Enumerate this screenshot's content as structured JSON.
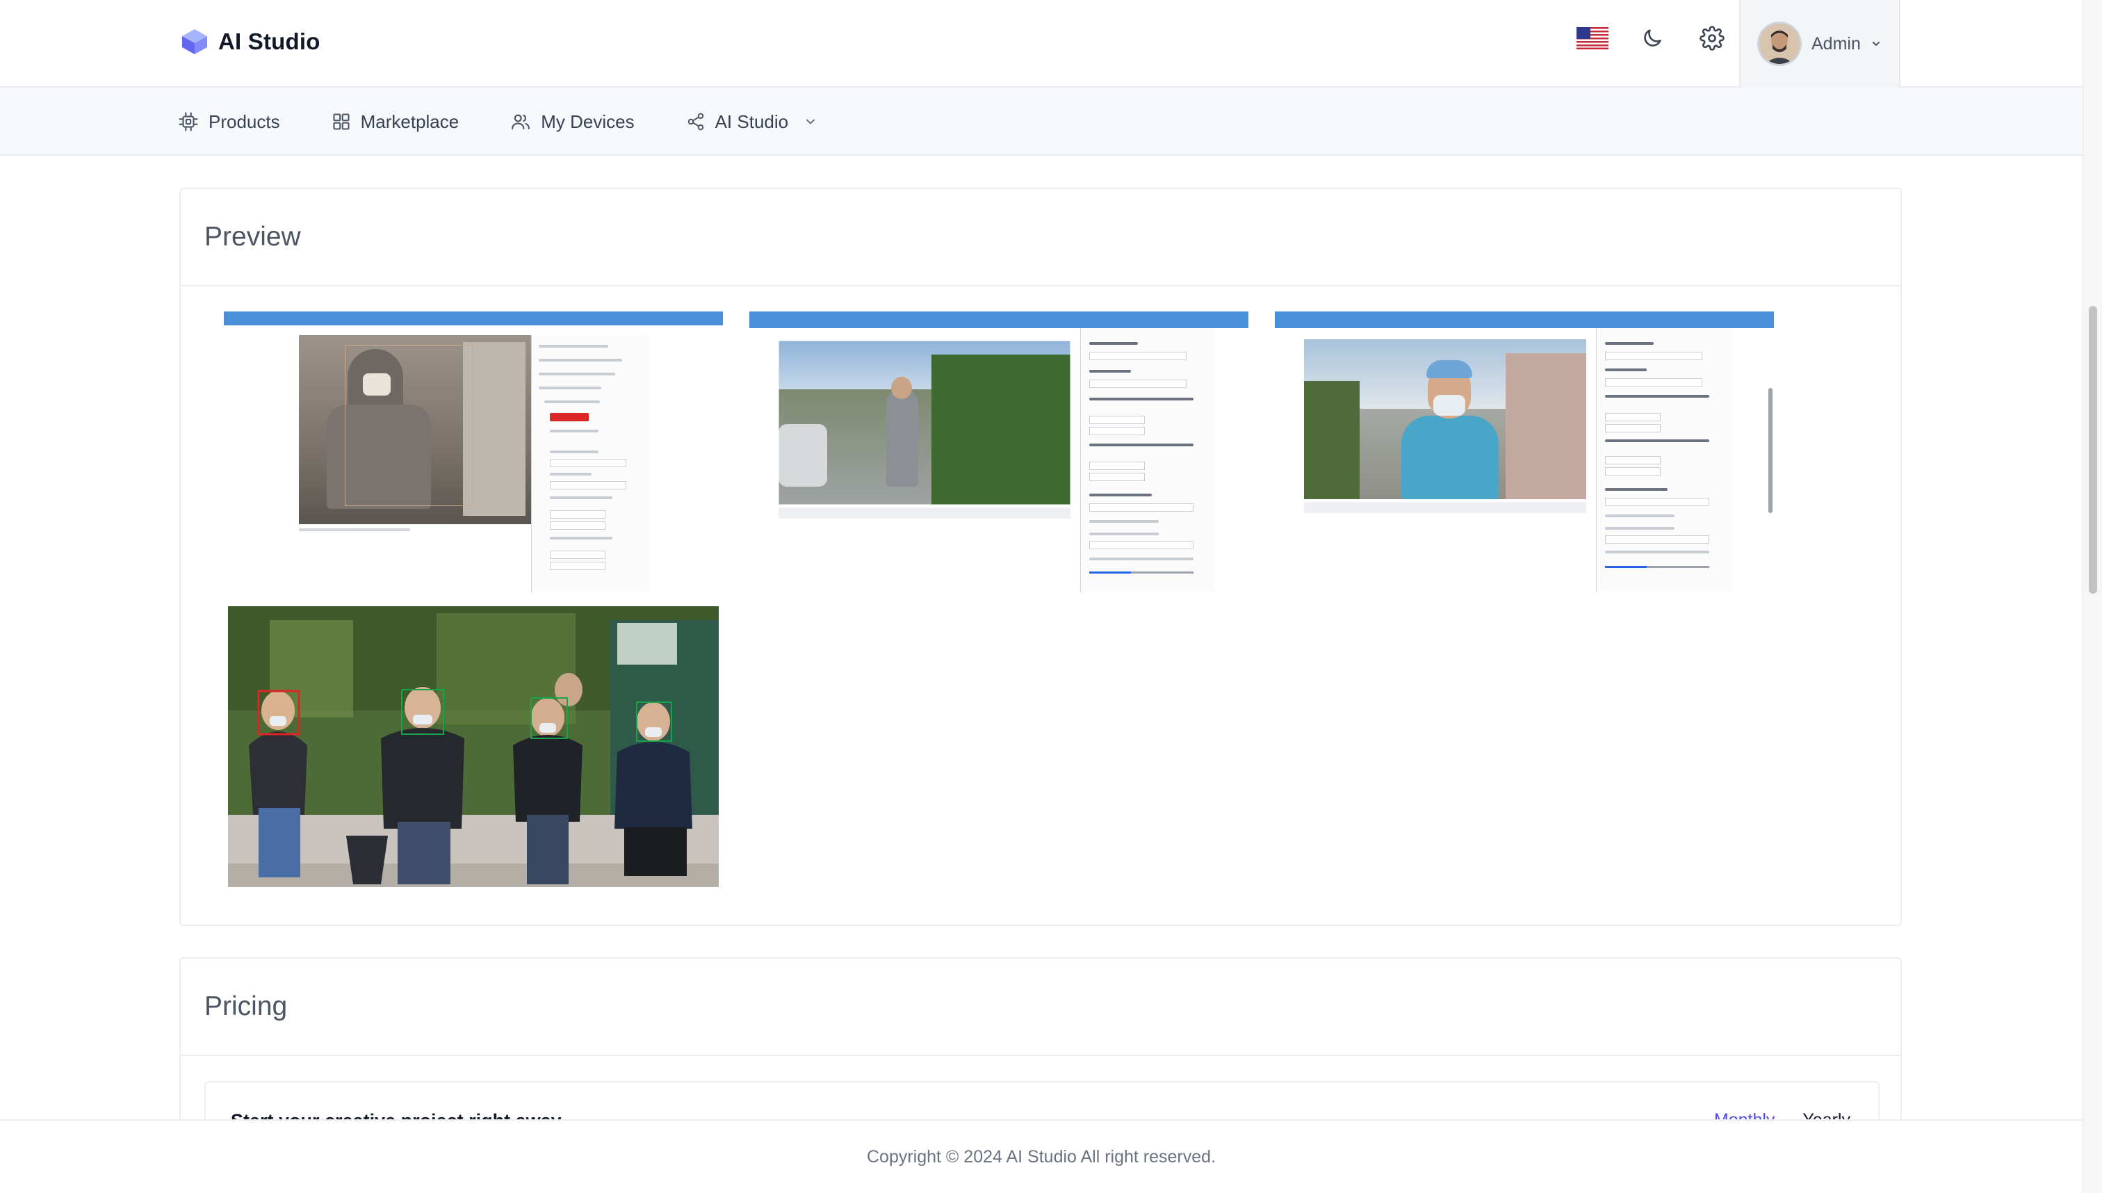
{
  "app": {
    "brand_name": "AI Studio",
    "brand_color": "#6366f1"
  },
  "header": {
    "language_flag": "us-flag-icon",
    "user_name": "Admin"
  },
  "nav": {
    "items": [
      {
        "label": "Products",
        "icon": "chip-icon"
      },
      {
        "label": "Marketplace",
        "icon": "grid-icon"
      },
      {
        "label": "My Devices",
        "icon": "users-icon"
      },
      {
        "label": "AI Studio",
        "icon": "share-icon",
        "has_dropdown": true
      }
    ]
  },
  "preview": {
    "title": "Preview",
    "images": [
      {
        "name": "preview-image-1"
      },
      {
        "name": "preview-image-2"
      },
      {
        "name": "preview-image-3"
      },
      {
        "name": "preview-image-4"
      }
    ]
  },
  "pricing": {
    "title": "Pricing",
    "tagline": "Start your creative project right away",
    "monthly_label": "Monthly",
    "yearly_label": "Yearly"
  },
  "footer": {
    "copyright": "Copyright © 2024 AI Studio All right reserved."
  }
}
